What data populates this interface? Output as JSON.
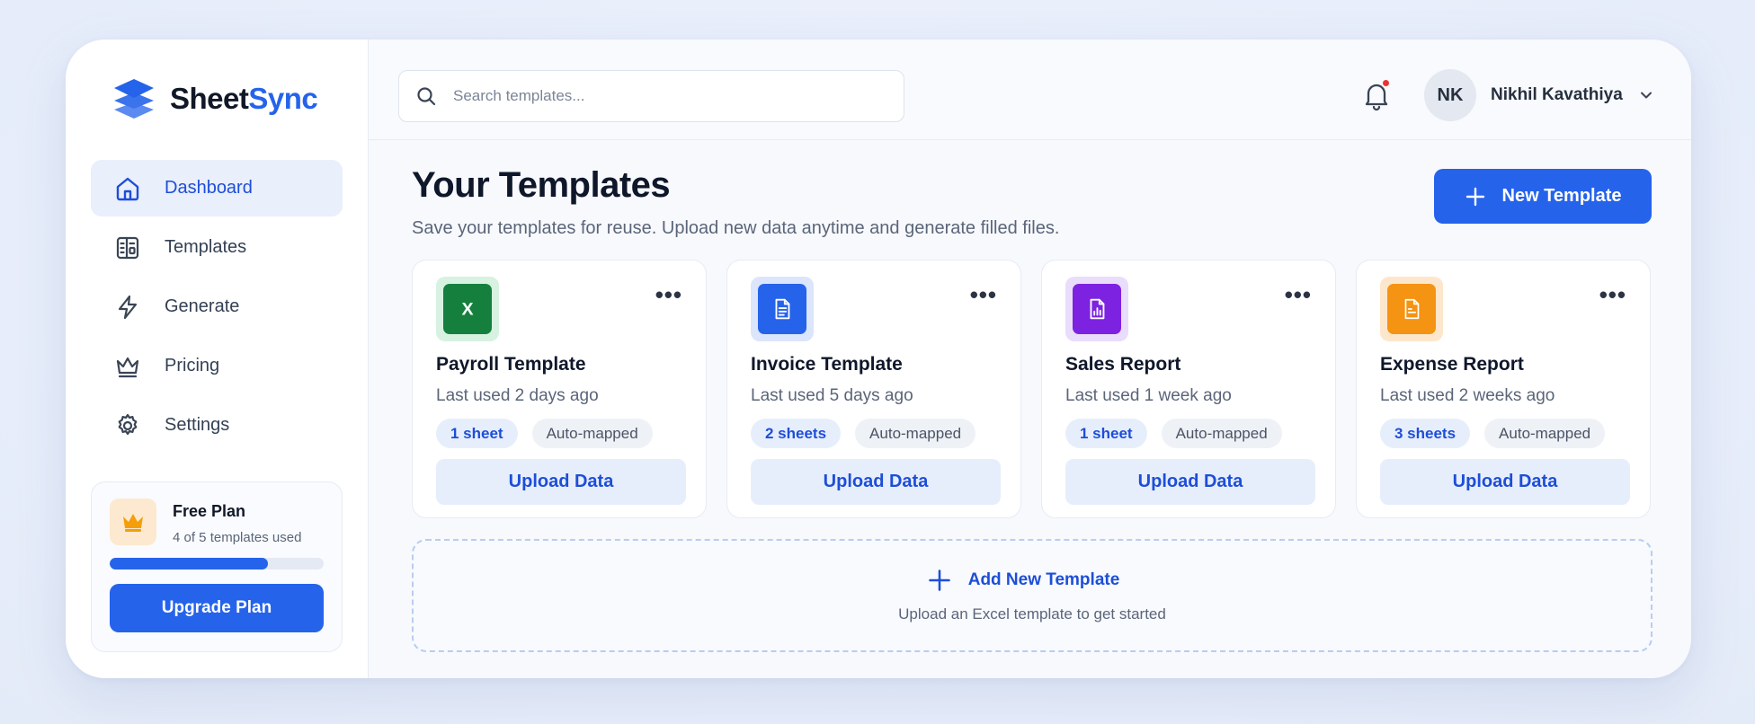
{
  "brand": {
    "name_part1": "Sheet",
    "name_part2": "Sync",
    "logo_icon": "stacked-layers-icon",
    "accent": "#2563eb"
  },
  "sidebar": {
    "items": [
      {
        "label": "Dashboard",
        "icon": "home-icon",
        "active": true
      },
      {
        "label": "Templates",
        "icon": "templates-icon",
        "active": false
      },
      {
        "label": "Generate",
        "icon": "lightning-icon",
        "active": false
      },
      {
        "label": "Pricing",
        "icon": "crown-icon",
        "active": false
      },
      {
        "label": "Settings",
        "icon": "gear-icon",
        "active": false
      }
    ],
    "plan": {
      "title": "Free Plan",
      "usage": "4 of 5 templates used",
      "progress_fraction": 0.74,
      "button": "Upgrade Plan"
    }
  },
  "topbar": {
    "search_placeholder": "Search templates...",
    "notification_badge_color": "#ef3131",
    "user": {
      "initials": "NK",
      "name": "Nikhil Kavathiya"
    }
  },
  "main": {
    "title": "Your Templates",
    "subtitle": "Save your templates for reuse. Upload new data anytime and generate filled files.",
    "new_button": "New Template",
    "cards": [
      {
        "title": "Payroll Template",
        "last_used": "Last used 2 days ago",
        "sheets": "1 sheet",
        "mapping": "Auto-mapped",
        "button": "Upload Data",
        "icon": "excel-icon",
        "icon_bg": "#d7f2e1",
        "icon_fg": "#15803d"
      },
      {
        "title": "Invoice Template",
        "last_used": "Last used 5 days ago",
        "sheets": "2 sheets",
        "mapping": "Auto-mapped",
        "button": "Upload Data",
        "icon": "document-icon",
        "icon_bg": "#dbe5fb",
        "icon_fg": "#2563eb"
      },
      {
        "title": "Sales Report",
        "last_used": "Last used 1 week ago",
        "sheets": "1 sheet",
        "mapping": "Auto-mapped",
        "button": "Upload Data",
        "icon": "chart-document-icon",
        "icon_bg": "#eadcfb",
        "icon_fg": "#7c22e0"
      },
      {
        "title": "Expense Report",
        "last_used": "Last used 2 weeks ago",
        "sheets": "3 sheets",
        "mapping": "Auto-mapped",
        "button": "Upload Data",
        "icon": "receipt-icon",
        "icon_bg": "#fde7cc",
        "icon_fg": "#f59312"
      }
    ],
    "add_template": {
      "label": "Add New Template",
      "hint": "Upload an Excel template to get started"
    }
  }
}
